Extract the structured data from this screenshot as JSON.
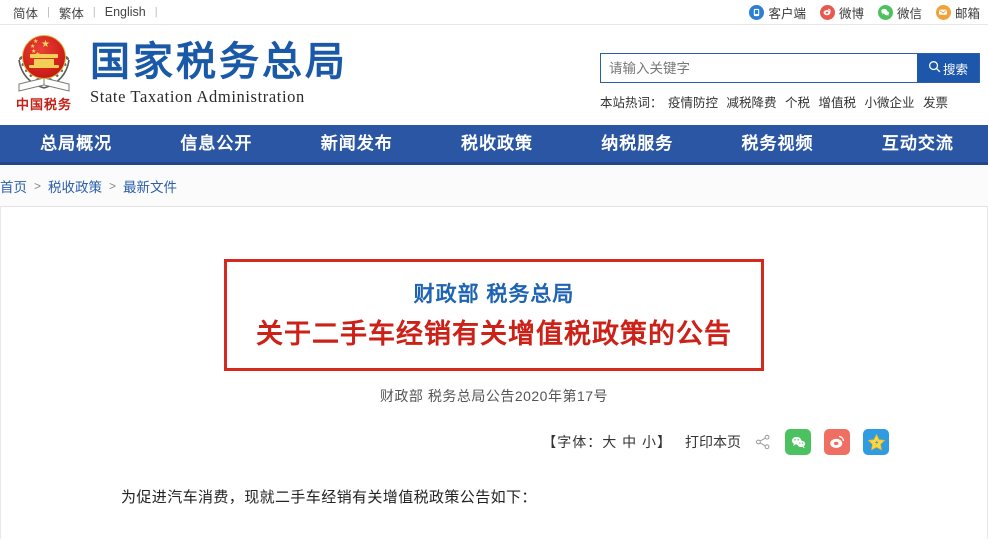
{
  "topbar": {
    "languages": [
      {
        "label": "简体"
      },
      {
        "label": "繁体"
      },
      {
        "label": "English"
      }
    ],
    "separator": "|",
    "social": [
      {
        "label": "客户端",
        "icon": "app-client-icon",
        "color": "#2b7fd4"
      },
      {
        "label": "微博",
        "icon": "weibo-icon",
        "color": "#e8584f"
      },
      {
        "label": "微信",
        "icon": "wechat-icon",
        "color": "#4cc15f"
      },
      {
        "label": "邮箱",
        "icon": "mail-icon",
        "color": "#f0a23c"
      }
    ]
  },
  "header": {
    "emblem_text": "中国税务",
    "brand_cn": "国家税务总局",
    "brand_en": "State Taxation Administration",
    "search": {
      "placeholder": "请输入关键字",
      "value": "",
      "button_label": "搜索",
      "hotwords_label": "本站热词：",
      "hotwords": [
        "疫情防控",
        "减税降费",
        "个税",
        "增值税",
        "小微企业",
        "发票"
      ]
    }
  },
  "nav": {
    "items": [
      {
        "label": "总局概况"
      },
      {
        "label": "信息公开"
      },
      {
        "label": "新闻发布"
      },
      {
        "label": "税收政策"
      },
      {
        "label": "纳税服务"
      },
      {
        "label": "税务视频"
      },
      {
        "label": "互动交流"
      }
    ],
    "background": "#2a56a4"
  },
  "breadcrumb": {
    "items": [
      {
        "label": "首页"
      },
      {
        "label": "税收政策"
      },
      {
        "label": "最新文件"
      }
    ],
    "separator": ">"
  },
  "article": {
    "dept": "财政部 税务总局",
    "title": "关于二手车经销有关增值税政策的公告",
    "doc_no": "财政部 税务总局公告2020年第17号",
    "title_border_color": "#d6291e",
    "title_color": "#cc2118",
    "dept_color": "#1f63b4",
    "toolbar": {
      "font_prefix": "【字体：",
      "size_large": "大",
      "size_medium": "中",
      "size_small": "小",
      "font_suffix": "】",
      "print_label": "打印本页",
      "share_icon": "share-nodes-icon",
      "wechat_icon": "wechat-square-icon",
      "weibo_icon": "weibo-square-icon",
      "favorite_icon": "favorite-star-icon"
    },
    "paragraphs": [
      "为促进汽车消费，现就二手车经销有关增值税政策公告如下："
    ]
  }
}
